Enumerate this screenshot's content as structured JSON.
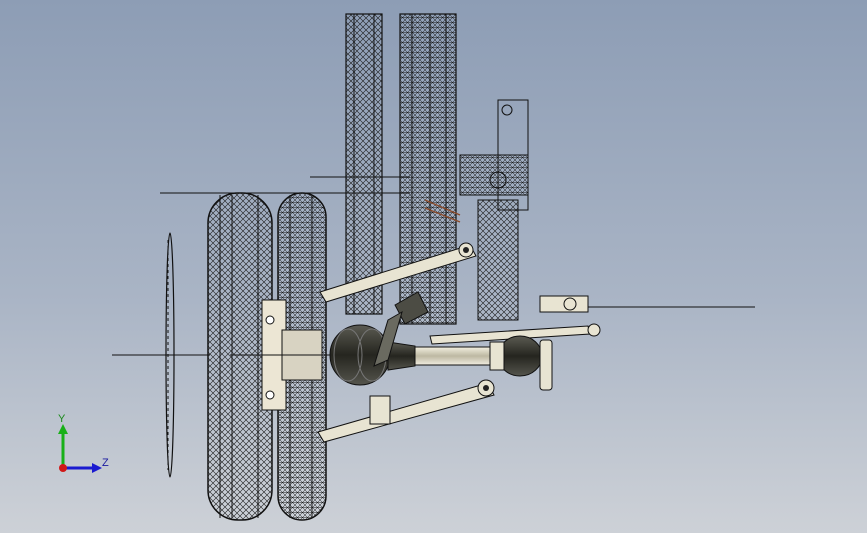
{
  "viewport": {
    "background_top": "#8d9db5",
    "background_bottom": "#cdd1d7",
    "model_line_color": "#151515",
    "boot_color": "#3d3d36",
    "shaft_color": "#e8e4d2"
  },
  "triad": {
    "y_label": "Y",
    "z_label": "Z",
    "y_color": "#18b018",
    "z_color": "#1a1ad0",
    "x_color": "#d01818",
    "icons": [
      "y-axis-arrow-icon",
      "z-axis-arrow-icon",
      "x-axis-origin-icon"
    ]
  }
}
